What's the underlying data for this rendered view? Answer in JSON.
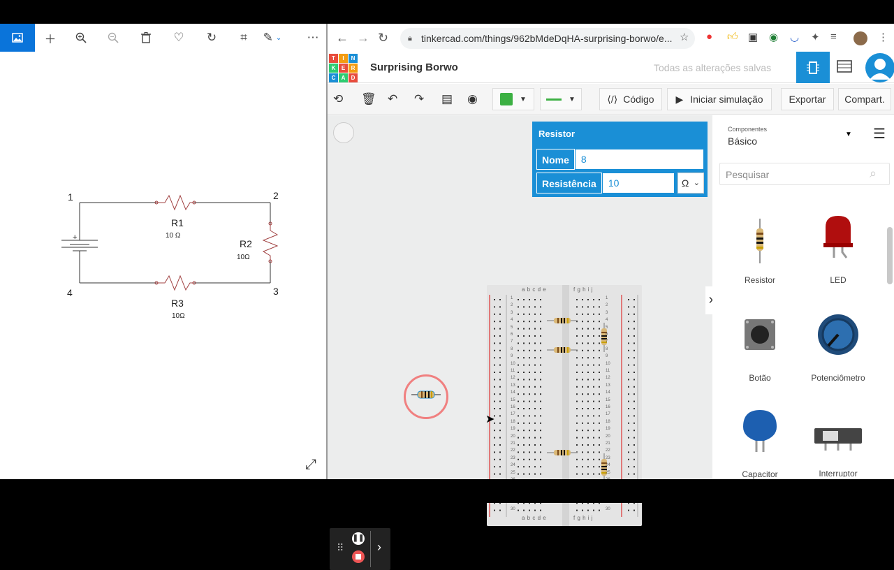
{
  "viewer": {
    "icons": [
      "image-icon",
      "plus-icon",
      "zoom-in-icon",
      "zoom-out-icon",
      "trash-icon",
      "heart-icon",
      "rotate-icon",
      "crop-icon",
      "edit-icon",
      "more-icon"
    ]
  },
  "schematic": {
    "nodes": [
      "1",
      "2",
      "3",
      "4"
    ],
    "r1": {
      "name": "R1",
      "value": "10 Ω"
    },
    "r2": {
      "name": "R2",
      "value": "10Ω"
    },
    "r3": {
      "name": "R3",
      "value": "10Ω"
    },
    "battery_sign": "+"
  },
  "browser": {
    "url": "tinkercad.com/things/962bMdeDqHA-surprising-borwo/e..."
  },
  "tinkercad": {
    "logo": [
      "T",
      "I",
      "N",
      "K",
      "E",
      "R",
      "C",
      "A",
      "D"
    ],
    "logo_colors": [
      "#e84c3d",
      "#f39c12",
      "#1a8fd6",
      "#2ecc71",
      "#e84c3d",
      "#f39c12",
      "#1a8fd6",
      "#2ecc71",
      "#e84c3d"
    ],
    "title": "Surprising Borwo",
    "saved": "Todas as alterações salvas",
    "toolbar": {
      "code": "Código",
      "simulate": "Iniciar simulação",
      "export": "Exportar",
      "share": "Compart."
    },
    "wire_color": "#3cb043",
    "panel": {
      "title": "Resistor",
      "name_label": "Nome",
      "name_value": "8",
      "resistance_label": "Resistência",
      "resistance_value": "10",
      "unit": "Ω"
    },
    "breadboard": {
      "cols_left": "a b c d e",
      "cols_right": "f g h i j",
      "rows": [
        "1",
        "2",
        "3",
        "4",
        "5",
        "6",
        "7",
        "8",
        "9",
        "10",
        "11",
        "12",
        "13",
        "14",
        "15",
        "16",
        "17",
        "18",
        "19",
        "20",
        "21",
        "22",
        "23",
        "24",
        "25",
        "26",
        "27",
        "28",
        "29",
        "30"
      ]
    },
    "components": {
      "category_label": "Componentes",
      "category": "Básico",
      "search_placeholder": "Pesquisar",
      "items": [
        {
          "name": "Resistor"
        },
        {
          "name": "LED"
        },
        {
          "name": "Botão"
        },
        {
          "name": "Potenciômetro"
        },
        {
          "name": "Capacitor"
        },
        {
          "name": "Interruptor deslizante"
        }
      ]
    }
  }
}
